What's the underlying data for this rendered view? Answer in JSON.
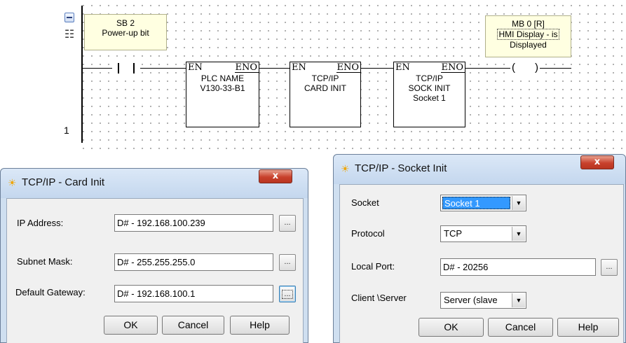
{
  "ladder": {
    "rung_number": "1",
    "contact_comment": {
      "line1": "SB 2",
      "line2": "Power-up bit"
    },
    "coil_comment": {
      "line1": "MB 0 [R]",
      "line2": "HMI Display - is",
      "line3": "Displayed"
    },
    "coil_symbol": {
      "left": "(",
      "right": ")"
    },
    "function_blocks": [
      {
        "en": "EN",
        "eno": "ENO",
        "lines": [
          "PLC NAME",
          "V130-33-B1"
        ]
      },
      {
        "en": "EN",
        "eno": "ENO",
        "lines": [
          "TCP/IP",
          "CARD INIT"
        ]
      },
      {
        "en": "EN",
        "eno": "ENO",
        "lines": [
          "TCP/IP",
          "SOCK INIT",
          "Socket 1"
        ]
      }
    ]
  },
  "card_init": {
    "title": "TCP/IP - Card Init",
    "close_label": "x",
    "fields": [
      {
        "label": "IP Address:",
        "value": "D# - 192.168.100.239",
        "browse": "..."
      },
      {
        "label": "Subnet Mask:",
        "value": "D# - 255.255.255.0",
        "browse": "..."
      },
      {
        "label": "Default Gateway:",
        "value": "D# - 192.168.100.1",
        "browse": "..."
      }
    ],
    "buttons": {
      "ok": "OK",
      "cancel": "Cancel",
      "help": "Help"
    }
  },
  "socket_init": {
    "title": "TCP/IP - Socket Init",
    "close_label": "x",
    "socket": {
      "label": "Socket",
      "value": "Socket 1"
    },
    "protocol": {
      "label": "Protocol",
      "value": "TCP"
    },
    "local_port": {
      "label": "Local Port:",
      "value": "D# - 20256",
      "browse": "..."
    },
    "client_server": {
      "label": "Client \\Server",
      "value": "Server (slave"
    },
    "buttons": {
      "ok": "OK",
      "cancel": "Cancel",
      "help": "Help"
    }
  },
  "colors": {
    "comment_bg": "#ffffe1",
    "dialog_frame": "#cfdff0",
    "close_red": "#c8412c",
    "selection_blue": "#3399ff"
  },
  "icons": {
    "collapse": "collapse-icon",
    "stack": "stack-icon",
    "title": "sun-icon",
    "dropdown": "chevron-down-icon"
  }
}
